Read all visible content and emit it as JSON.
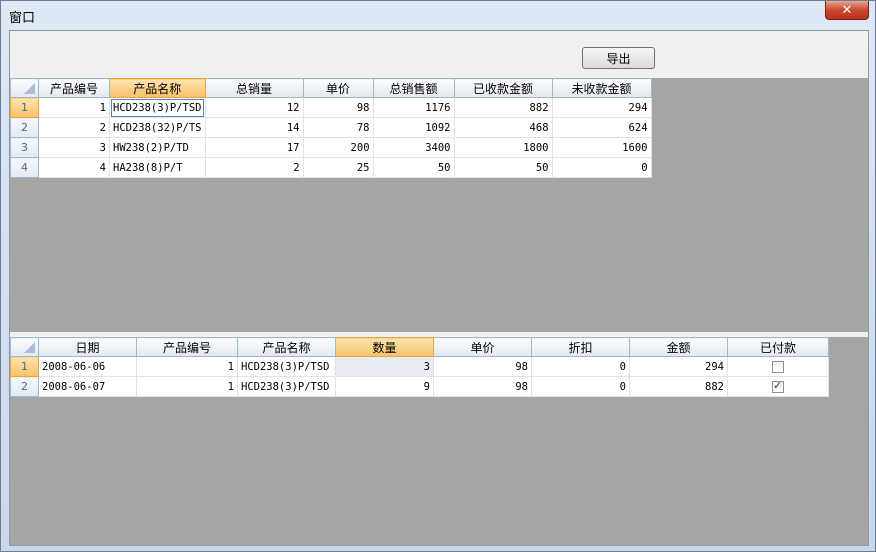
{
  "window": {
    "title": "窗口",
    "close_label": "✕"
  },
  "toolbar": {
    "export_label": "导出"
  },
  "top_grid": {
    "columns": [
      "产品编号",
      "产品名称",
      "总销量",
      "单价",
      "总销售额",
      "已收款金额",
      "未收款金额"
    ],
    "rows": [
      {
        "row_no": "1",
        "cells": [
          "1",
          "HCD238(3)P/TSD",
          "12",
          "98",
          "1176",
          "882",
          "294"
        ]
      },
      {
        "row_no": "2",
        "cells": [
          "2",
          "HCD238(32)P/TS",
          "14",
          "78",
          "1092",
          "468",
          "624"
        ]
      },
      {
        "row_no": "3",
        "cells": [
          "3",
          "HW238(2)P/TD",
          "17",
          "200",
          "3400",
          "1800",
          "1600"
        ]
      },
      {
        "row_no": "4",
        "cells": [
          "4",
          "HA238(8)P/T",
          "2",
          "25",
          "50",
          "50",
          "0"
        ]
      }
    ]
  },
  "bottom_grid": {
    "columns": [
      "日期",
      "产品编号",
      "产品名称",
      "数量",
      "单价",
      "折扣",
      "金额",
      "已付款"
    ],
    "rows": [
      {
        "row_no": "1",
        "cells": [
          "2008-06-06",
          "1",
          "HCD238(3)P/TSD",
          "3",
          "98",
          "0",
          "294"
        ],
        "paid": false
      },
      {
        "row_no": "2",
        "cells": [
          "2008-06-07",
          "1",
          "HCD238(3)P/TSD",
          "9",
          "98",
          "0",
          "882"
        ],
        "paid": true
      }
    ]
  }
}
